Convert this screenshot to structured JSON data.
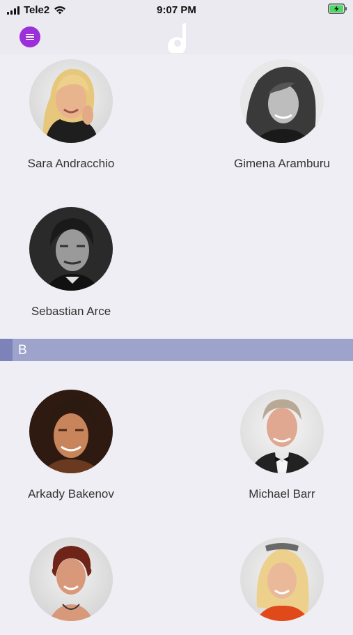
{
  "status": {
    "carrier": "Tele2",
    "time": "9:07 PM"
  },
  "section_a": {
    "people": [
      {
        "name": "Sara Andracchio"
      },
      {
        "name": "Gimena Aramburu"
      },
      {
        "name": "Sebastian Arce"
      }
    ]
  },
  "section_b": {
    "letter": "B",
    "people": [
      {
        "name": "Arkady Bakenov"
      },
      {
        "name": "Michael Barr"
      },
      {
        "name": ""
      },
      {
        "name": ""
      }
    ]
  },
  "colors": {
    "accent": "#9b2fd8",
    "section_bar": "#9ea3cb",
    "section_accent": "#7d83b9",
    "background": "#efeef4"
  }
}
